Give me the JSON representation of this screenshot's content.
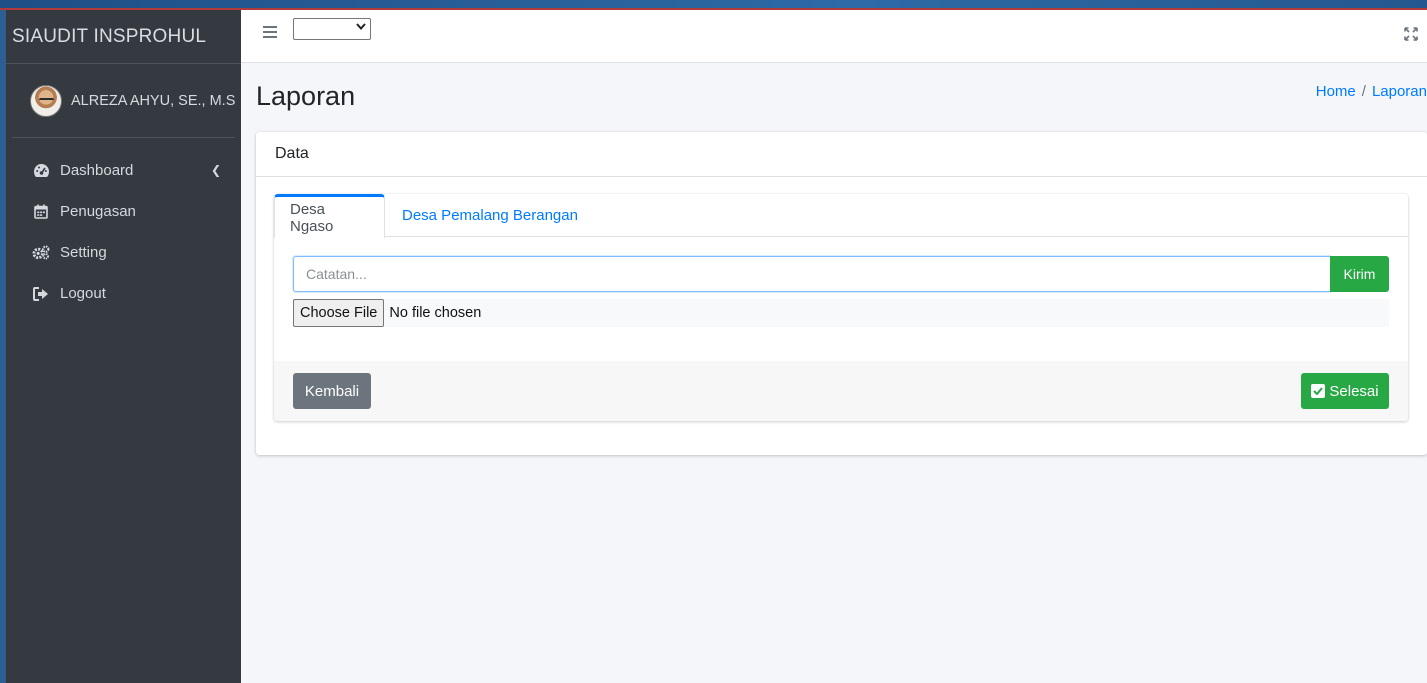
{
  "app": {
    "brand": "SIAUDIT INSPROHUL"
  },
  "user": {
    "name": "ALREZA AHYU, SE., M.Si. Ak"
  },
  "sidebar": {
    "items": [
      {
        "label": "Dashboard",
        "icon": "dashboard-icon",
        "has_arrow": true
      },
      {
        "label": "Penugasan",
        "icon": "calendar-icon"
      },
      {
        "label": "Setting",
        "icon": "gears-icon"
      },
      {
        "label": "Logout",
        "icon": "sign-out-icon"
      }
    ]
  },
  "topbar": {
    "menu_icon": "hamburger-icon",
    "select_value": "",
    "fullscreen_icon": "expand-icon"
  },
  "page": {
    "title": "Laporan",
    "breadcrumb": [
      "Home",
      "Laporan"
    ]
  },
  "card": {
    "header": "Data",
    "tabs": [
      {
        "label": "Desa Ngaso",
        "active": true
      },
      {
        "label": "Desa Pemalang Berangan",
        "active": false
      }
    ],
    "note_placeholder": "Catatan...",
    "send_label": "Kirim",
    "file_button": "Choose File",
    "file_status": "No file chosen",
    "back_label": "Kembali",
    "done_label": "Selesai"
  },
  "colors": {
    "sidebar_bg": "#343a40",
    "primary": "#007bff",
    "success": "#28a745",
    "secondary": "#6c757d",
    "content_bg": "#f4f6f9"
  }
}
